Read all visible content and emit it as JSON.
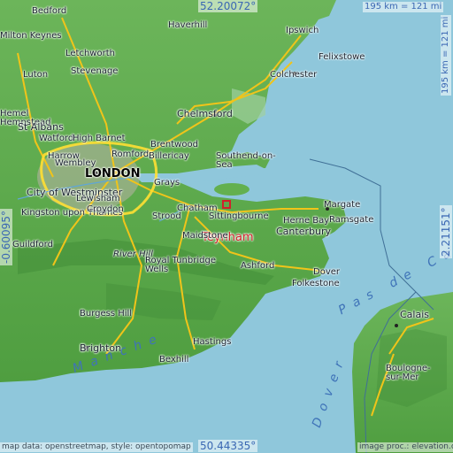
{
  "map": {
    "featured_place": "Teynham",
    "colors": {
      "sea": "#8fc7db",
      "land": "#5dab4a",
      "major_road": "#f0c41a",
      "motorway": "#ffdf33",
      "river": "#5fa6d6",
      "featured": "#d2202a",
      "border": "#3f6f96"
    },
    "labels": [
      {
        "name": "Bedford"
      },
      {
        "name": "Milton Keynes"
      },
      {
        "name": "Luton"
      },
      {
        "name": "Letchworth"
      },
      {
        "name": "Stevenage"
      },
      {
        "name": "Haverhill"
      },
      {
        "name": "Ipswich"
      },
      {
        "name": "Felixstowe"
      },
      {
        "name": "Colchester"
      },
      {
        "name": "Hemel Hempstead"
      },
      {
        "name": "St Albans"
      },
      {
        "name": "Watford"
      },
      {
        "name": "High Barnet"
      },
      {
        "name": "Chelmsford"
      },
      {
        "name": "Brentwood"
      },
      {
        "name": "Romford"
      },
      {
        "name": "Billericay"
      },
      {
        "name": "Southend-on-Sea"
      },
      {
        "name": "Harrow"
      },
      {
        "name": "Wembley"
      },
      {
        "name": "LONDON"
      },
      {
        "name": "City of Westminster"
      },
      {
        "name": "Lewisham"
      },
      {
        "name": "Grays"
      },
      {
        "name": "Kingston upon Thames"
      },
      {
        "name": "Croydon"
      },
      {
        "name": "Chatham"
      },
      {
        "name": "Strood"
      },
      {
        "name": "Sittingbourne"
      },
      {
        "name": "Margate"
      },
      {
        "name": "Herne Bay"
      },
      {
        "name": "Ramsgate"
      },
      {
        "name": "Canterbury"
      },
      {
        "name": "Teynham"
      },
      {
        "name": "Maidstone"
      },
      {
        "name": "Guildford"
      },
      {
        "name": "River Hill"
      },
      {
        "name": "Royal Tunbridge Wells"
      },
      {
        "name": "Ashford"
      },
      {
        "name": "Dover"
      },
      {
        "name": "Folkestone"
      },
      {
        "name": "Calais"
      },
      {
        "name": "Burgess Hill"
      },
      {
        "name": "Boulogne-sur-Mer"
      },
      {
        "name": "Brighton"
      },
      {
        "name": "Hastings"
      },
      {
        "name": "Bexhill"
      }
    ],
    "seas": [
      {
        "name": "Manche"
      },
      {
        "name": "Pas de Calais"
      },
      {
        "name": "Dover"
      }
    ]
  },
  "coords": {
    "north": "52.20072°",
    "south": "50.44335°",
    "west": "-0.60095°",
    "east": "2.21151°"
  },
  "scale": {
    "top": "195 km = 121 mi",
    "side": "195 km = 121 mi"
  },
  "attribution": {
    "left": "map data: openstreetmap, style: opentopomap",
    "right": "image proc.: elevation.city"
  }
}
